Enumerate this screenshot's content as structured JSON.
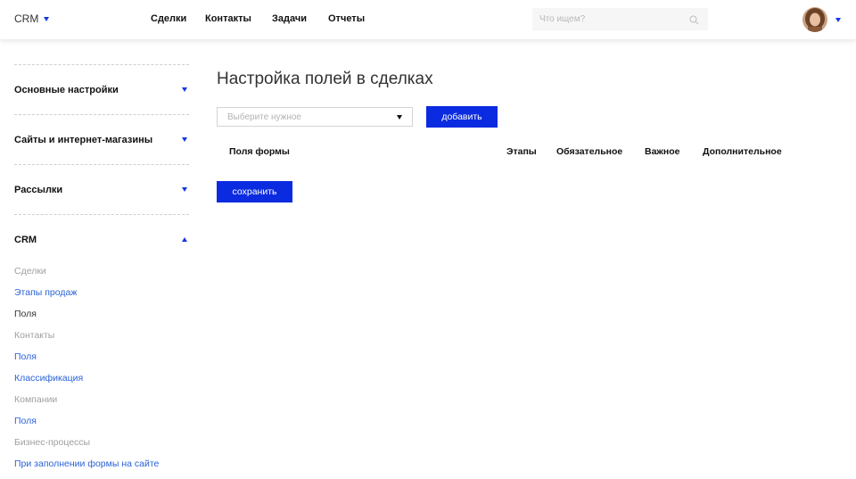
{
  "header": {
    "brand": "CRM",
    "nav": [
      "Сделки",
      "Контакты",
      "Задачи",
      "Отчеты"
    ],
    "search_placeholder": "Что ищем?"
  },
  "sidebar": {
    "sections": [
      {
        "label": "Основные настройки",
        "expanded": false
      },
      {
        "label": "Сайты и интернет-магазины",
        "expanded": false
      },
      {
        "label": "Рассылки",
        "expanded": false
      },
      {
        "label": "CRM",
        "expanded": true
      }
    ],
    "crm_items": [
      {
        "label": "Сделки",
        "kind": "group"
      },
      {
        "label": "Этапы продаж",
        "kind": "link"
      },
      {
        "label": "Поля",
        "kind": "active"
      },
      {
        "label": "Контакты",
        "kind": "group"
      },
      {
        "label": "Поля",
        "kind": "link"
      },
      {
        "label": "Классификация",
        "kind": "link"
      },
      {
        "label": "Компании",
        "kind": "group"
      },
      {
        "label": "Поля",
        "kind": "link"
      },
      {
        "label": "Бизнес-процессы",
        "kind": "group"
      },
      {
        "label": "При заполнении формы на сайте",
        "kind": "link"
      }
    ]
  },
  "main": {
    "title": "Настройка полей в сделках",
    "select_placeholder": "Выберите нужное",
    "add_label": "добавить",
    "columns": [
      "Поля формы",
      "Этапы",
      "Обязательное",
      "Важное",
      "Дополнительное"
    ],
    "save_label": "сохранить"
  },
  "colors": {
    "accent": "#0b2be0",
    "link": "#2b63d9",
    "muted": "#a0a0a0"
  }
}
